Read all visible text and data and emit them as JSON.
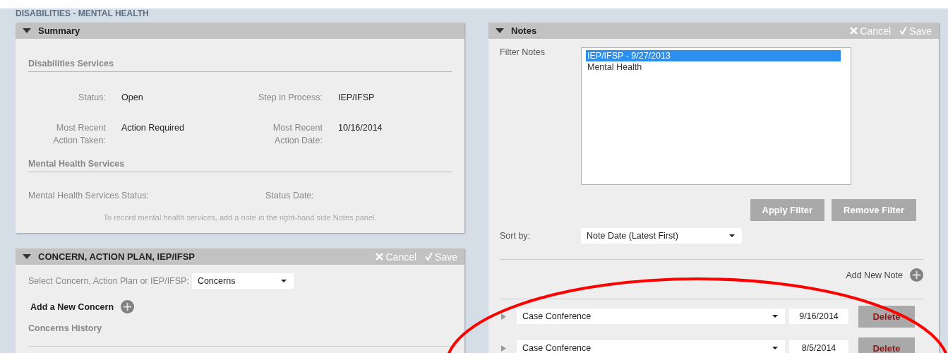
{
  "page_title": "DISABILITIES - MENTAL HEALTH",
  "summary": {
    "title": "Summary",
    "expanded": true,
    "disabilities_heading": "Disabilities Services",
    "fields": [
      {
        "label": "Status:",
        "value": "Open"
      },
      {
        "label": "Step in Process:",
        "value": "IEP/IFSP"
      },
      {
        "label": "Most Recent Action Taken:",
        "value": "Action Required"
      },
      {
        "label": "Most Recent Action Date:",
        "value": "10/16/2014"
      }
    ],
    "mental_heading": "Mental Health Services",
    "mental_fields": [
      {
        "label": "Mental Health Services Status:"
      },
      {
        "label": "Status Date:"
      }
    ],
    "note": "To record mental health services, add a note in the right-hand side Notes panel."
  },
  "concern": {
    "title": "CONCERN, ACTION PLAN, IEP/IFSP",
    "expanded": true,
    "cancel": "Cancel",
    "save": "Save",
    "select_label": "Select Concern, Action Plan or IEP/IFSP:",
    "select_value": "Concerns",
    "add_label": "Add a New Concern",
    "history_heading": "Concerns History"
  },
  "notes": {
    "title": "Notes",
    "expanded": true,
    "cancel": "Cancel",
    "save": "Save",
    "filter_label": "Filter Notes",
    "filter_options": [
      {
        "label": "IEP/IFSP - 9/27/2013",
        "selected": true
      },
      {
        "label": "Mental Health",
        "selected": false
      }
    ],
    "apply_button": "Apply Filter",
    "remove_button": "Remove Filter",
    "sort_label": "Sort by:",
    "sort_value": "Note Date (Latest First)",
    "add_label": "Add New Note",
    "rows": [
      {
        "type": "Case Conference",
        "date": "9/16/2014",
        "expanded": false,
        "delete": "Delete"
      },
      {
        "type": "Case Conference",
        "date": "8/5/2014",
        "expanded": false,
        "delete": "Delete"
      }
    ]
  },
  "annotation": {
    "kind": "ellipse",
    "color": "#ff0000"
  }
}
